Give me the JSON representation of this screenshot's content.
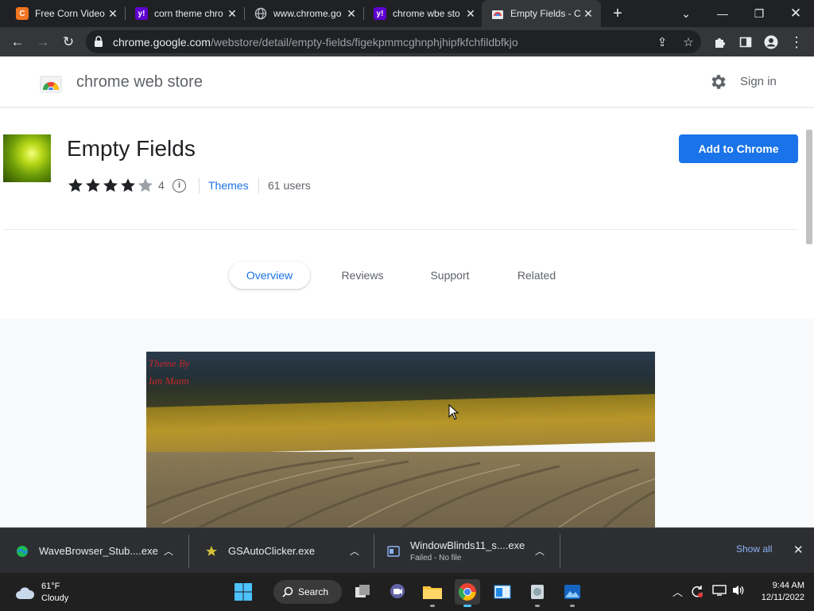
{
  "browser": {
    "tabs": [
      {
        "title": "Free Corn Video",
        "favicon": "crunchyroll-icon",
        "active": false
      },
      {
        "title": "corn theme chro",
        "favicon": "yahoo-icon",
        "active": false
      },
      {
        "title": "www.chrome.go",
        "favicon": "globe-icon",
        "active": false
      },
      {
        "title": "chrome wbe sto",
        "favicon": "yahoo-icon",
        "active": false
      },
      {
        "title": "Empty Fields - C",
        "favicon": "chrome-web-store-icon",
        "active": true
      }
    ],
    "url_host": "chrome.google.com",
    "url_path": "/webstore/detail/empty-fields/figekpmmcghnphjhipfkfchfildbfkjo"
  },
  "store": {
    "title": "chrome web store",
    "sign_in": "Sign in"
  },
  "extension": {
    "name": "Empty Fields",
    "rating_count": "4",
    "stars": 4,
    "category": "Themes",
    "users": "61 users",
    "add_button": "Add to Chrome"
  },
  "page_tabs": [
    "Overview",
    "Reviews",
    "Support",
    "Related"
  ],
  "screenshot": {
    "credit_line1": "Theme By",
    "credit_line2": "Ian Mann"
  },
  "downloads": {
    "items": [
      {
        "name": "WaveBrowser_Stub....exe",
        "status": ""
      },
      {
        "name": "GSAutoClicker.exe",
        "status": ""
      },
      {
        "name": "WindowBlinds11_s....exe",
        "status": "Failed - No file"
      }
    ],
    "show_all": "Show all"
  },
  "taskbar": {
    "weather_temp": "61°F",
    "weather_desc": "Cloudy",
    "search_label": "Search",
    "time": "9:44 AM",
    "date": "12/11/2022"
  },
  "colors": {
    "accent": "#1a73e8",
    "tab_bg": "#202124",
    "toolbar_bg": "#35363a"
  }
}
